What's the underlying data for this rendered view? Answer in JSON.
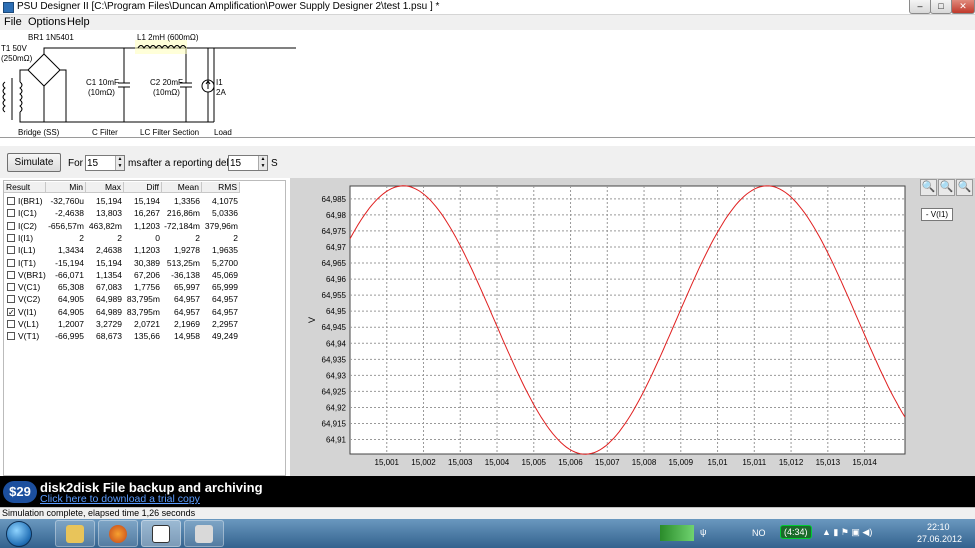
{
  "window": {
    "title": "PSU Designer II  [C:\\Program Files\\Duncan Amplification\\Power Supply Designer 2\\test 1.psu ] *",
    "min": "–",
    "max": "□",
    "close": "✕"
  },
  "menu": [
    "File",
    "Options",
    "Help"
  ],
  "schematic": {
    "br": "BR1 1N5401",
    "t1": "T1 50V",
    "t1r": "(250mΩ)",
    "c1a": "C1 10mF",
    "c1b": "(10mΩ)",
    "l1": "L1 2mH (600mΩ)",
    "c2a": "C2 20mF",
    "c2b": "(10mΩ)",
    "i1a": "I1",
    "i1b": "2A",
    "sec_bridge": "Bridge (SS)",
    "sec_cfilter": "C Filter",
    "sec_lc": "LC Filter Section",
    "sec_load": "Load"
  },
  "controls": {
    "simulate": "Simulate",
    "for": "For",
    "for_value": "15",
    "ms": "ms",
    "delay_label": "after a reporting delay of",
    "delay_value": "15",
    "s": "S"
  },
  "table": {
    "headers": [
      "Result",
      "Min",
      "Max",
      "Diff",
      "Mean",
      "RMS"
    ],
    "rows": [
      {
        "name": "I(BR1)",
        "min": "-32,760u",
        "max": "15,194",
        "diff": "15,194",
        "mean": "1,3356",
        "rms": "4,1075",
        "checked": false
      },
      {
        "name": "I(C1)",
        "min": "-2,4638",
        "max": "13,803",
        "diff": "16,267",
        "mean": "216,86m",
        "rms": "5,0336",
        "checked": false
      },
      {
        "name": "I(C2)",
        "min": "-656,57m",
        "max": "463,82m",
        "diff": "1,1203",
        "mean": "-72,184m",
        "rms": "379,96m",
        "checked": false
      },
      {
        "name": "I(I1)",
        "min": "2",
        "max": "2",
        "diff": "0",
        "mean": "2",
        "rms": "2",
        "checked": false
      },
      {
        "name": "I(L1)",
        "min": "1,3434",
        "max": "2,4638",
        "diff": "1,1203",
        "mean": "1,9278",
        "rms": "1,9635",
        "checked": false
      },
      {
        "name": "I(T1)",
        "min": "-15,194",
        "max": "15,194",
        "diff": "30,389",
        "mean": "513,25m",
        "rms": "5,2700",
        "checked": false
      },
      {
        "name": "V(BR1)",
        "min": "-66,071",
        "max": "1,1354",
        "diff": "67,206",
        "mean": "-36,138",
        "rms": "45,069",
        "checked": false
      },
      {
        "name": "V(C1)",
        "min": "65,308",
        "max": "67,083",
        "diff": "1,7756",
        "mean": "65,997",
        "rms": "65,999",
        "checked": false
      },
      {
        "name": "V(C2)",
        "min": "64,905",
        "max": "64,989",
        "diff": "83,795m",
        "mean": "64,957",
        "rms": "64,957",
        "checked": false
      },
      {
        "name": "V(I1)",
        "min": "64,905",
        "max": "64,989",
        "diff": "83,795m",
        "mean": "64,957",
        "rms": "64,957",
        "checked": true
      },
      {
        "name": "V(L1)",
        "min": "1,2007",
        "max": "3,2729",
        "diff": "2,0721",
        "mean": "2,1969",
        "rms": "2,2957",
        "checked": false
      },
      {
        "name": "V(T1)",
        "min": "-66,995",
        "max": "68,673",
        "diff": "135,66",
        "mean": "14,958",
        "rms": "49,249",
        "checked": false
      }
    ]
  },
  "chart_data": {
    "type": "line",
    "ylabel": "V",
    "xlabel": "",
    "legend": "- V(I1)",
    "line_color": "#e02020",
    "grid": true,
    "xlim": [
      15.0,
      15.0151
    ],
    "ylim": [
      64.9055,
      64.989
    ],
    "x_ticks": [
      "15,001",
      "15,002",
      "15,003",
      "15,004",
      "15,005",
      "15,006",
      "15,007",
      "15,008",
      "15,009",
      "15,01",
      "15,011",
      "15,012",
      "15,013",
      "15,014"
    ],
    "x_tick_values": [
      15.001,
      15.002,
      15.003,
      15.004,
      15.005,
      15.006,
      15.007,
      15.008,
      15.009,
      15.01,
      15.011,
      15.012,
      15.013,
      15.014
    ],
    "y_ticks": [
      "64,985",
      "64,98",
      "64,975",
      "64,97",
      "64,965",
      "64,96",
      "64,955",
      "64,95",
      "64,945",
      "64,94",
      "64,935",
      "64,93",
      "64,925",
      "64,92",
      "64,915",
      "64,91"
    ],
    "y_tick_values": [
      64.985,
      64.98,
      64.975,
      64.97,
      64.965,
      64.96,
      64.955,
      64.95,
      64.945,
      64.94,
      64.935,
      64.93,
      64.925,
      64.92,
      64.915,
      64.91
    ],
    "series": [
      {
        "name": "V(I1)",
        "x": [
          15.0,
          15.001,
          15.0012,
          15.002,
          15.003,
          15.004,
          15.005,
          15.006,
          15.007,
          15.008,
          15.009,
          15.01,
          15.0112,
          15.012,
          15.013,
          15.014,
          15.0151
        ],
        "y": [
          64.981,
          64.9885,
          64.989,
          64.987,
          64.975,
          64.955,
          64.931,
          64.906,
          64.912,
          64.928,
          64.95,
          64.975,
          64.989,
          64.985,
          64.966,
          64.94,
          64.917
        ]
      }
    ]
  },
  "ad": {
    "price": "$29",
    "title": "disk2disk File backup and archiving",
    "link": "Click here to download a trial copy"
  },
  "status": "Simulation complete, elapsed time 1,26 seconds",
  "taskbar": {
    "lang": "NO",
    "battery": "(4:34)",
    "time": "22:10",
    "date": "27.06.2012"
  }
}
